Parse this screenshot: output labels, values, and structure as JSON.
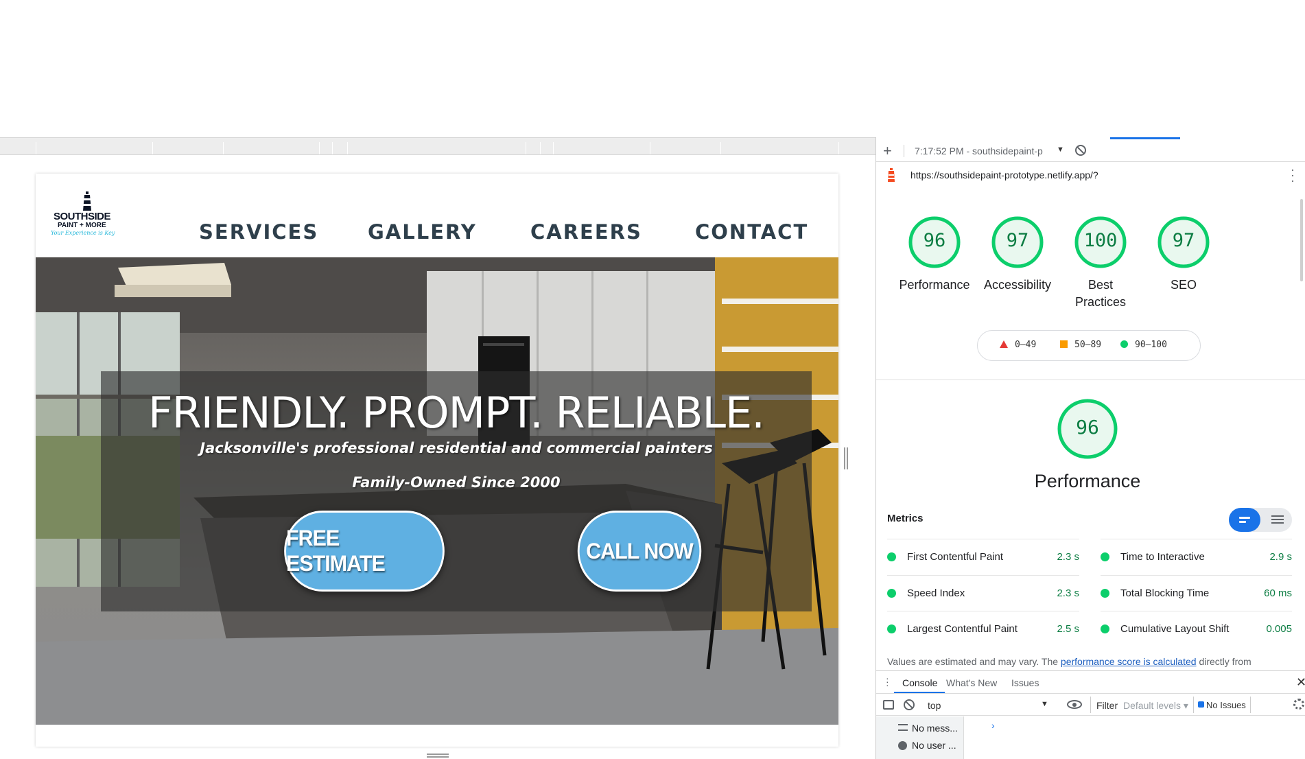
{
  "site": {
    "logo": {
      "line1": "SOUTHSIDE",
      "line2": "PAINT + MORE",
      "tagline": "Your Experience is Key"
    },
    "nav": [
      "SERVICES",
      "GALLERY",
      "CAREERS",
      "CONTACT"
    ],
    "hero": {
      "title": "FRIENDLY. PROMPT. RELIABLE.",
      "subtitle": "Jacksonville's professional residential and commercial painters",
      "family": "Family-Owned Since 2000",
      "btn_estimate": "FREE ESTIMATE",
      "btn_call": "CALL NOW"
    }
  },
  "devtools": {
    "toolbar": {
      "plus": "+",
      "run_label": "7:17:52 PM - southsidepaint-p",
      "caret": "▼"
    },
    "url": "https://southsidepaint-prototype.netlify.app/?",
    "gauges": [
      {
        "score": "96",
        "label": "Performance"
      },
      {
        "score": "97",
        "label": "Accessibility"
      },
      {
        "score": "100",
        "label": "Best Practices"
      },
      {
        "score": "97",
        "label": "SEO"
      }
    ],
    "legend": {
      "fail": "0–49",
      "average": "50–89",
      "pass": "90–100"
    },
    "performance": {
      "score": "96",
      "title": "Performance"
    },
    "metrics_header": "Metrics",
    "metrics": [
      {
        "name": "First Contentful Paint",
        "value": "2.3 s"
      },
      {
        "name": "Time to Interactive",
        "value": "2.9 s"
      },
      {
        "name": "Speed Index",
        "value": "2.3 s"
      },
      {
        "name": "Total Blocking Time",
        "value": "60 ms"
      },
      {
        "name": "Largest Contentful Paint",
        "value": "2.5 s"
      },
      {
        "name": "Cumulative Layout Shift",
        "value": "0.005"
      }
    ],
    "note": {
      "prefix": "Values are estimated and may vary. The ",
      "link": "performance score is calculated",
      "suffix": " directly from"
    },
    "colors": {
      "pass": "#0cce6b",
      "pass_text": "#0c7d43",
      "accent": "#1a73e8"
    },
    "drawer": {
      "tabs": [
        "Console",
        "What's New",
        "Issues"
      ],
      "context": "top",
      "filter": "Filter",
      "levels": "Default levels",
      "issues": "No Issues",
      "side_rows": [
        "No mess...",
        "No user ..."
      ],
      "prompt": "›"
    }
  }
}
